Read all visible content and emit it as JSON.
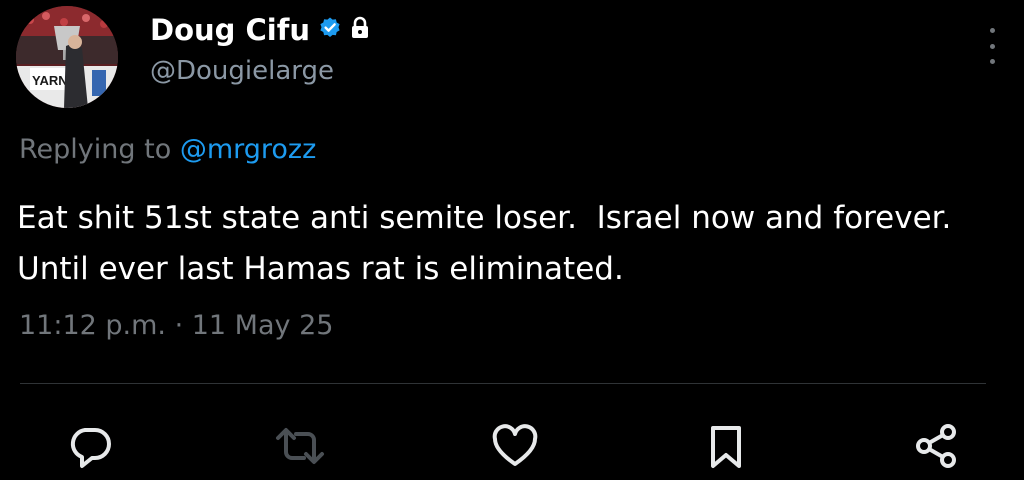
{
  "author": {
    "display_name": "Doug Cifu",
    "handle": "@Dougielarge",
    "avatar_banner_text": "YARN",
    "verified_icon": "verified-badge-icon",
    "protected_icon": "lock-icon"
  },
  "reply": {
    "prefix": "Replying to ",
    "mention": "@mrgrozz"
  },
  "tweet": {
    "text": "Eat shit 51st state anti semite loser.  Israel now and forever.  Until ever last Hamas rat is eliminated.",
    "timestamp": "11:12 p.m. · 11 May 25"
  },
  "actions": [
    {
      "name": "reply",
      "icon": "comment-icon"
    },
    {
      "name": "repost",
      "icon": "repost-icon"
    },
    {
      "name": "like",
      "icon": "heart-icon"
    },
    {
      "name": "bookmark",
      "icon": "bookmark-icon"
    },
    {
      "name": "share",
      "icon": "share-icon"
    }
  ],
  "colors": {
    "background": "#000000",
    "text_primary": "#ffffff",
    "text_secondary": "#71767b",
    "accent": "#1d9bf0",
    "icon": "#e7e9ea",
    "divider": "#2f3336"
  }
}
